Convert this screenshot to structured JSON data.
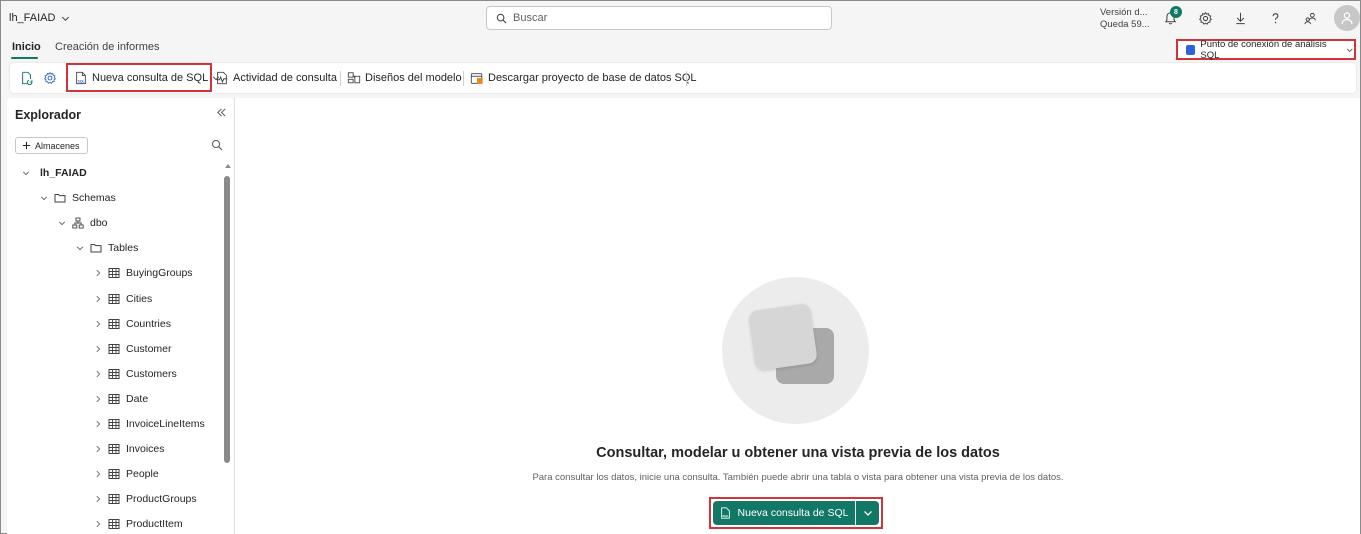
{
  "topbar": {
    "workspace": "lh_FAIAD",
    "search_placeholder": "Buscar",
    "version_line1": "Versión d...",
    "version_line2": "Queda 59...",
    "notification_count": "8"
  },
  "tabs": [
    {
      "label": "Inicio",
      "active": true
    },
    {
      "label": "Creación de informes",
      "active": false
    }
  ],
  "endpoint_selector": {
    "label": "Punto de conexión de análisis SQL"
  },
  "toolbar": {
    "new_query": "Nueva consulta de SQL",
    "query_activity": "Actividad de consulta",
    "model_layouts": "Diseños del modelo",
    "download_project": "Descargar proyecto de base de datos SQL"
  },
  "explorer": {
    "title": "Explorador",
    "add_button": "Almacenes",
    "tree": [
      {
        "label": "lh_FAIAD",
        "level": 0,
        "icon": "none"
      },
      {
        "label": "Schemas",
        "level": 1,
        "icon": "folder-icon"
      },
      {
        "label": "dbo",
        "level": 2,
        "icon": "schema-icon"
      },
      {
        "label": "Tables",
        "level": 3,
        "icon": "folder-icon"
      },
      {
        "label": "BuyingGroups",
        "level": 4,
        "icon": "table-icon"
      },
      {
        "label": "Cities",
        "level": 4,
        "icon": "table-icon"
      },
      {
        "label": "Countries",
        "level": 4,
        "icon": "table-icon"
      },
      {
        "label": "Customer",
        "level": 4,
        "icon": "table-icon"
      },
      {
        "label": "Customers",
        "level": 4,
        "icon": "table-icon"
      },
      {
        "label": "Date",
        "level": 4,
        "icon": "table-icon"
      },
      {
        "label": "InvoiceLineItems",
        "level": 4,
        "icon": "table-icon"
      },
      {
        "label": "Invoices",
        "level": 4,
        "icon": "table-icon"
      },
      {
        "label": "People",
        "level": 4,
        "icon": "table-icon"
      },
      {
        "label": "ProductGroups",
        "level": 4,
        "icon": "table-icon"
      },
      {
        "label": "ProductItem",
        "level": 4,
        "icon": "table-icon"
      }
    ]
  },
  "main": {
    "headline": "Consultar, modelar u obtener una vista previa de los datos",
    "subline": "Para consultar los datos, inicie una consulta. También puede abrir una tabla o vista para obtener una vista previa de los datos.",
    "cta_label": "Nueva consulta de SQL"
  },
  "colors": {
    "accent": "#117865",
    "highlight": "#d13438",
    "endpoint_icon": "#2b65d9"
  }
}
